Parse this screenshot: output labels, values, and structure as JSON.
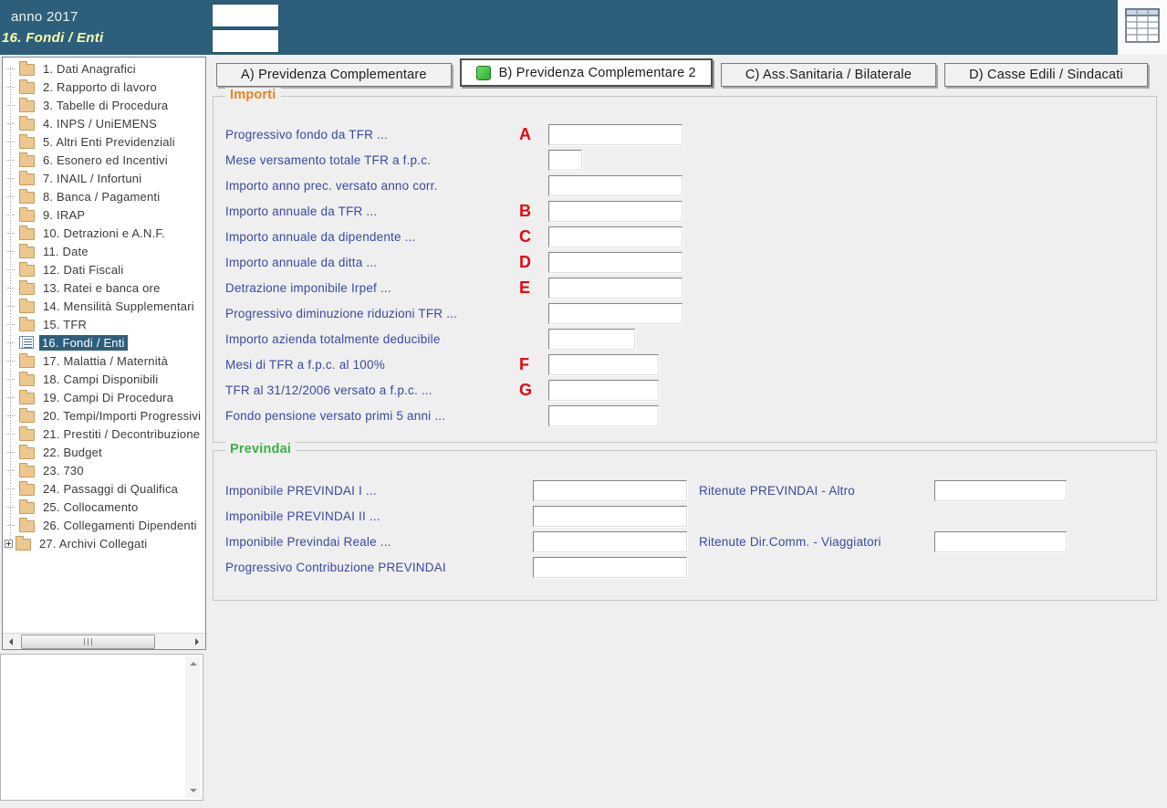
{
  "header": {
    "year_label": "anno 2017",
    "section_label": "16. Fondi / Enti",
    "box1_value": "",
    "box2_value": "",
    "grid_icon": "table-grid-icon",
    "accent_color": "#2d5f7c"
  },
  "tree": {
    "items": [
      {
        "label": "1. Dati Anagrafici",
        "icon": "folder"
      },
      {
        "label": "2. Rapporto di lavoro",
        "icon": "folder"
      },
      {
        "label": "3. Tabelle di Procedura",
        "icon": "folder"
      },
      {
        "label": "4. INPS / UniEMENS",
        "icon": "folder"
      },
      {
        "label": "5. Altri Enti Previdenziali",
        "icon": "folder"
      },
      {
        "label": "6. Esonero ed Incentivi",
        "icon": "folder"
      },
      {
        "label": "7. INAIL / Infortuni",
        "icon": "folder"
      },
      {
        "label": "8. Banca / Pagamenti",
        "icon": "folder"
      },
      {
        "label": "9. IRAP",
        "icon": "folder"
      },
      {
        "label": "10. Detrazioni e A.N.F.",
        "icon": "folder"
      },
      {
        "label": "11. Date",
        "icon": "folder"
      },
      {
        "label": "12. Dati Fiscali",
        "icon": "folder"
      },
      {
        "label": "13. Ratei e banca ore",
        "icon": "folder"
      },
      {
        "label": "14. Mensilità Supplementari",
        "icon": "folder"
      },
      {
        "label": "15. TFR",
        "icon": "folder"
      },
      {
        "label": "16. Fondi / Enti",
        "icon": "list",
        "selected": true
      },
      {
        "label": "17. Malattia / Maternità",
        "icon": "folder"
      },
      {
        "label": "18. Campi Disponibili",
        "icon": "folder"
      },
      {
        "label": "19. Campi Di Procedura",
        "icon": "folder"
      },
      {
        "label": "20. Tempi/Importi Progressivi",
        "icon": "folder"
      },
      {
        "label": "21. Prestiti / Decontribuzione",
        "icon": "folder"
      },
      {
        "label": "22. Budget",
        "icon": "folder"
      },
      {
        "label": "23. 730",
        "icon": "folder"
      },
      {
        "label": "24. Passaggi di Qualifica",
        "icon": "folder"
      },
      {
        "label": "25. Collocamento",
        "icon": "folder"
      },
      {
        "label": "26. Collegamenti Dipendenti",
        "icon": "folder"
      },
      {
        "label": "27. Archivi Collegati",
        "icon": "folder",
        "expander": true
      }
    ]
  },
  "tabs": [
    {
      "label": "A) Previdenza Complementare"
    },
    {
      "label": "B) Previdenza Complementare 2",
      "active": true,
      "icon": "green-square-icon"
    },
    {
      "label": "C) Ass.Sanitaria / Bilaterale"
    },
    {
      "label": "D) Casse Edili / Sindacati"
    }
  ],
  "importi": {
    "title": "Importi",
    "title_color": "#ea821d",
    "rows": [
      {
        "label": "Progressivo fondo da TFR ...",
        "letter": "A",
        "size": "lg",
        "value": ""
      },
      {
        "label": "Mese versamento totale TFR a f.p.c.",
        "letter": "",
        "size": "xs",
        "value": ""
      },
      {
        "label": "Importo anno prec. versato anno corr.",
        "letter": "",
        "size": "lg",
        "value": ""
      },
      {
        "label": "Importo annuale da TFR ...",
        "letter": "B",
        "size": "lg",
        "value": ""
      },
      {
        "label": "Importo annuale da dipendente ...",
        "letter": "C",
        "size": "lg",
        "value": ""
      },
      {
        "label": "Importo annuale da ditta ...",
        "letter": "D",
        "size": "lg",
        "value": ""
      },
      {
        "label": "Detrazione imponibile Irpef ...",
        "letter": "E",
        "size": "lg",
        "value": ""
      },
      {
        "label": "Progressivo diminuzione riduzioni TFR ...",
        "letter": "",
        "size": "lg",
        "value": ""
      },
      {
        "label": "Importo azienda totalmente deducibile",
        "letter": "",
        "size": "md",
        "value": ""
      },
      {
        "label": "Mesi di TFR a f.p.c. al 100%",
        "letter": "F",
        "size": "sm",
        "value": ""
      },
      {
        "label": "TFR al 31/12/2006 versato a f.p.c. ...",
        "letter": "G",
        "size": "sm",
        "value": ""
      },
      {
        "label": "Fondo pensione versato primi 5 anni ...",
        "letter": "",
        "size": "sm",
        "value": ""
      }
    ],
    "letter_color": "#e30613"
  },
  "previndai": {
    "title": "Previndai",
    "title_color": "#3daf49",
    "rows": [
      {
        "left_label": "Imponibile PREVINDAI I ...",
        "left_value": "",
        "right_label": "Ritenute PREVINDAI - Altro",
        "right_value": ""
      },
      {
        "left_label": "Imponibile PREVINDAI II ...",
        "left_value": ""
      },
      {
        "left_label": "Imponibile Previndai Reale ...",
        "left_value": "",
        "right_label": "Ritenute Dir.Comm. - Viaggiatori",
        "right_value": ""
      },
      {
        "left_label": "Progressivo Contribuzione PREVINDAI",
        "left_value": ""
      }
    ]
  }
}
